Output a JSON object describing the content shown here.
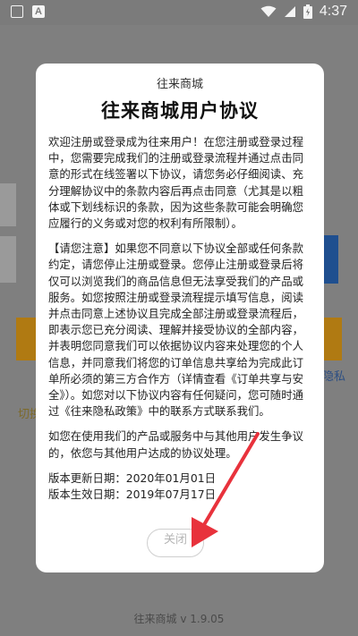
{
  "status_bar": {
    "time": "4:37"
  },
  "background": {
    "link_left": "切换",
    "link_right": "隐私",
    "version": "往来商城 v 1.9.05"
  },
  "dialog": {
    "subtitle": "往来商城",
    "title": "往来商城用户协议",
    "paragraph1": "欢迎注册或登录成为往来用户！在您注册或登录过程中，您需要完成我们的注册或登录流程并通过点击同意的形式在线签署以下协议，请您务必仔细阅读、充分理解协议中的条款内容后再点击同意（尤其是以粗体或下划线标识的条款，因为这些条款可能会明确您应履行的义务或对您的权利有所限制）。",
    "paragraph2": "【请您注意】如果您不同意以下协议全部或任何条款约定，请您停止注册或登录。您停止注册或登录后将仅可以浏览我们的商品信息但无法享受我们的产品或服务。如您按照注册或登录流程提示填写信息，阅读并点击同意上述协议且完成全部注册或登录流程后，即表示您已充分阅读、理解并接受协议的全部内容，并表明您同意我们可以依据协议内容来处理您的个人信息，并同意我们将您的订单信息共享给为完成此订单所必须的第三方合作方（详情查看《订单共享与安全》）。如您对以下协议内容有任何疑问，您可随时通过《往来隐私政策》中的联系方式联系我们。",
    "paragraph3": "如您在使用我们的产品或服务中与其他用户发生争议的，依您与其他用户达成的协议处理。",
    "update_date": "版本更新日期：2020年01月01日",
    "effective_date": "版本生效日期：2019年07月17日",
    "close_label": "关闭"
  },
  "colors": {
    "overlay": "#7f7f7f",
    "annotation_arrow": "#e8323c"
  },
  "icons": {
    "status_left": [
      "notification-box-icon",
      "a-badge-icon"
    ],
    "status_right": [
      "wifi-icon",
      "cellular-signal-icon",
      "battery-icon"
    ]
  }
}
